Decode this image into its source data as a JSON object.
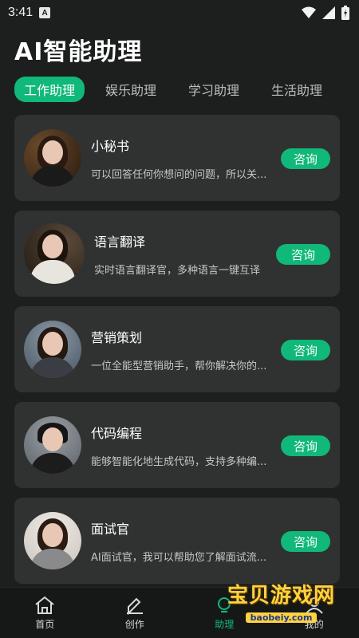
{
  "status_bar": {
    "time": "3:41"
  },
  "page": {
    "title": "AI智能助理"
  },
  "tabs": [
    {
      "label": "工作助理",
      "active": true
    },
    {
      "label": "娱乐助理",
      "active": false
    },
    {
      "label": "学习助理",
      "active": false
    },
    {
      "label": "生活助理",
      "active": false
    }
  ],
  "assistants": [
    {
      "name": "小秘书",
      "desc": "可以回答任何你想问的问题，所以关...",
      "button": "咨询"
    },
    {
      "name": "语言翻译",
      "desc": "实时语言翻译官，多种语言一键互译",
      "button": "咨询"
    },
    {
      "name": "营销策划",
      "desc": "一位全能型营销助手，帮你解决你的...",
      "button": "咨询"
    },
    {
      "name": "代码编程",
      "desc": "能够智能化地生成代码，支持多种编...",
      "button": "咨询"
    },
    {
      "name": "面试官",
      "desc": "AI面试官，我可以帮助您了解面试流...",
      "button": "咨询"
    }
  ],
  "bottom_nav": [
    {
      "label": "首页",
      "icon": "home-icon"
    },
    {
      "label": "创作",
      "icon": "pen-icon"
    },
    {
      "label": "助理",
      "icon": "lightbulb-icon",
      "active": true
    },
    {
      "label": "我的",
      "icon": "user-icon"
    }
  ],
  "watermark": {
    "title": "宝贝游戏网",
    "url": "baobeiy.com"
  },
  "colors": {
    "accent": "#10b87a",
    "background": "#1d1f1e",
    "card": "#303231"
  }
}
